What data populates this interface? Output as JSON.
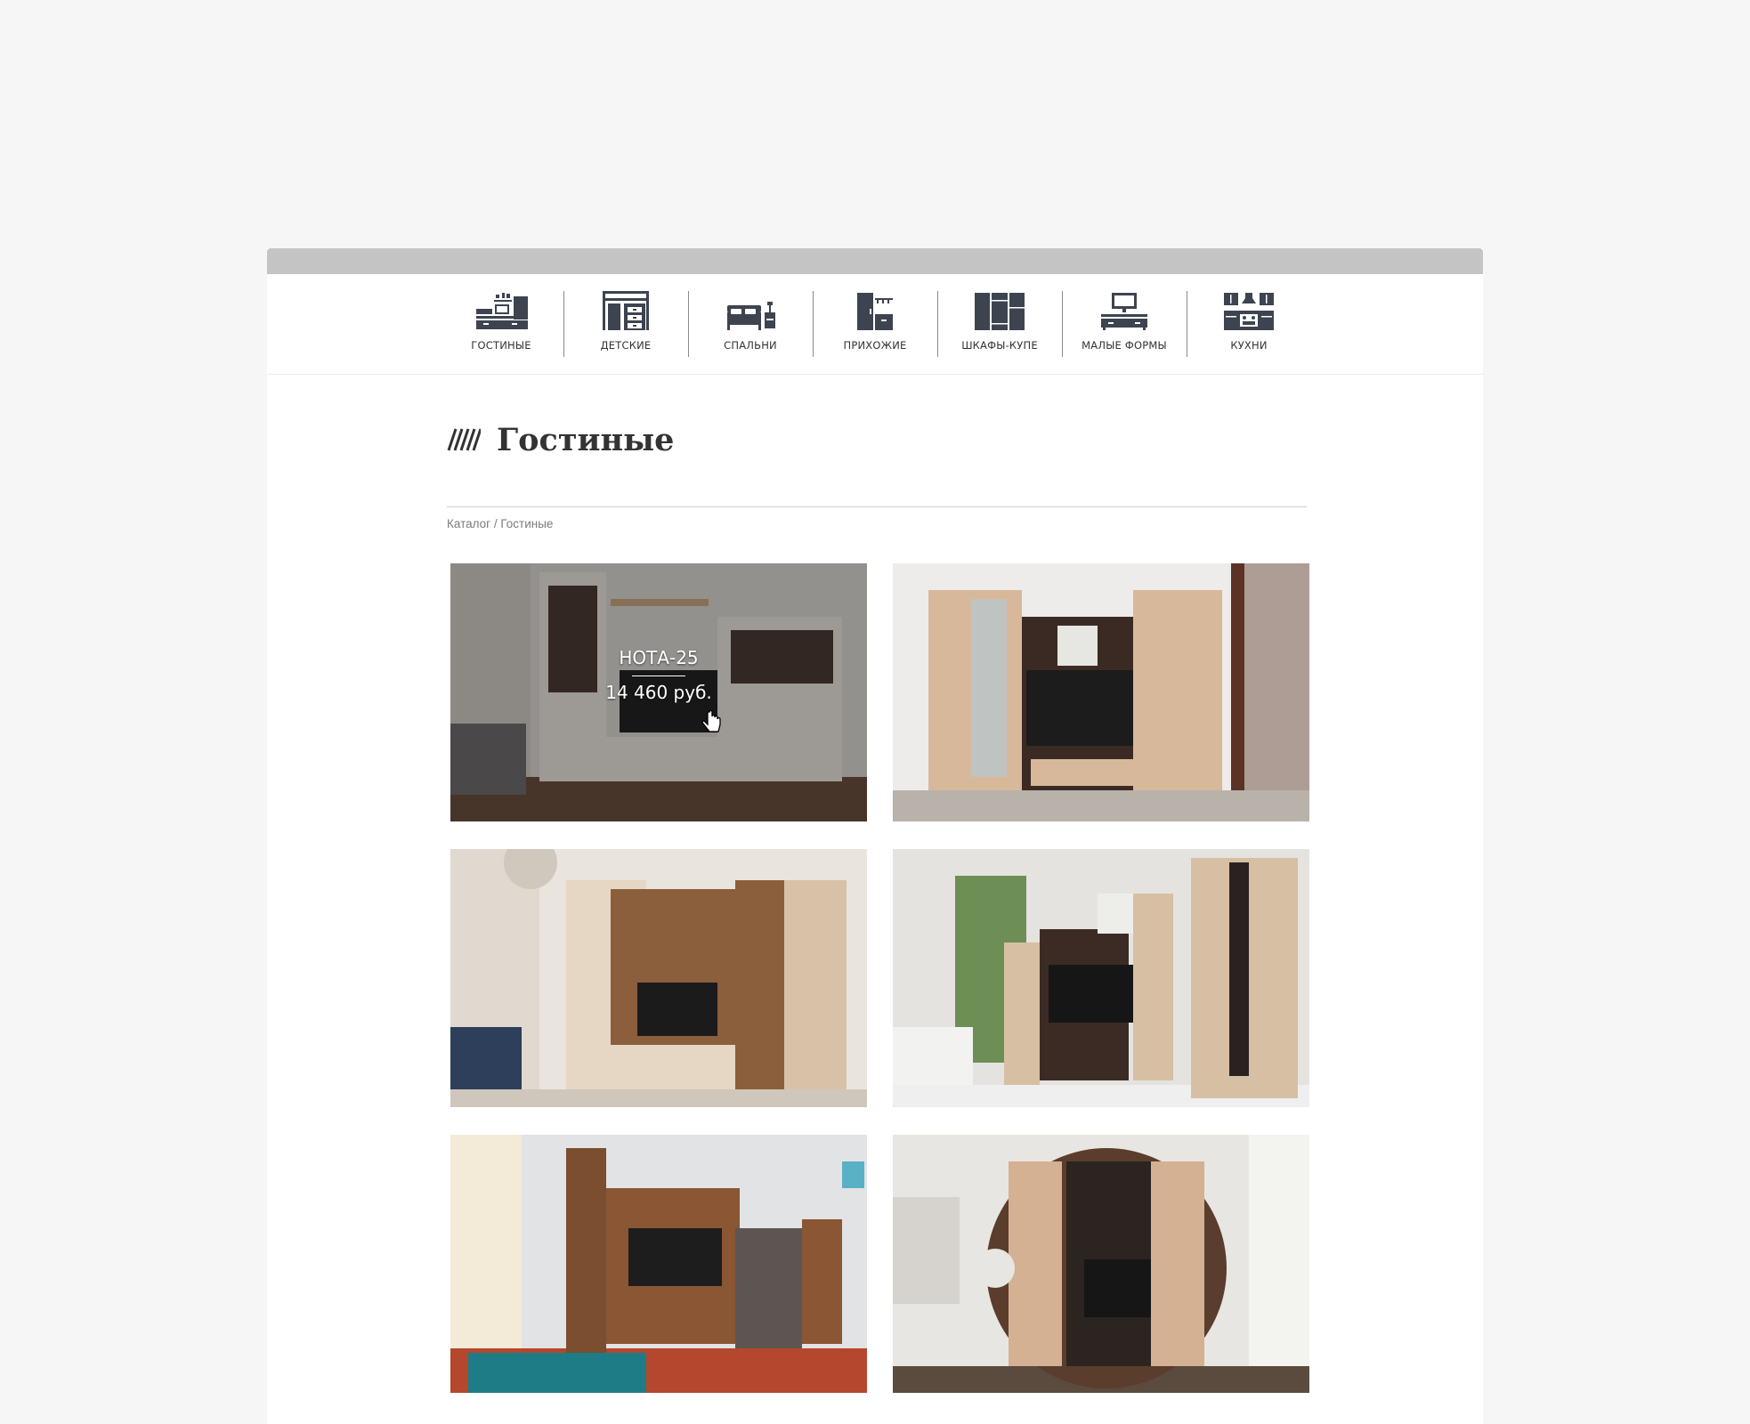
{
  "categories": [
    {
      "label": "ГОСТИНЫЕ",
      "icon": "living-room-icon"
    },
    {
      "label": "ДЕТСКИЕ",
      "icon": "kids-room-icon"
    },
    {
      "label": "СПАЛЬНИ",
      "icon": "bedroom-icon"
    },
    {
      "label": "ПРИХОЖИЕ",
      "icon": "hallway-icon"
    },
    {
      "label": "ШКАФЫ-КУПЕ",
      "icon": "wardrobe-icon"
    },
    {
      "label": "МАЛЫЕ ФОРМЫ",
      "icon": "small-forms-icon"
    },
    {
      "label": "КУХНИ",
      "icon": "kitchen-icon"
    }
  ],
  "page": {
    "title": "Гостиные",
    "breadcrumb": {
      "root": "Каталог",
      "separator": " / ",
      "current": "Гостиные"
    }
  },
  "products": [
    {
      "name": "НОТА-25",
      "price": "14 460 руб."
    },
    {
      "name": "",
      "price": ""
    },
    {
      "name": "",
      "price": ""
    },
    {
      "name": "",
      "price": ""
    },
    {
      "name": "",
      "price": ""
    },
    {
      "name": "",
      "price": ""
    }
  ],
  "colors": {
    "icon": "#3d4450",
    "window_bar": "#c4c4c4",
    "page_bg": "#f6f6f6",
    "title": "#333333"
  }
}
